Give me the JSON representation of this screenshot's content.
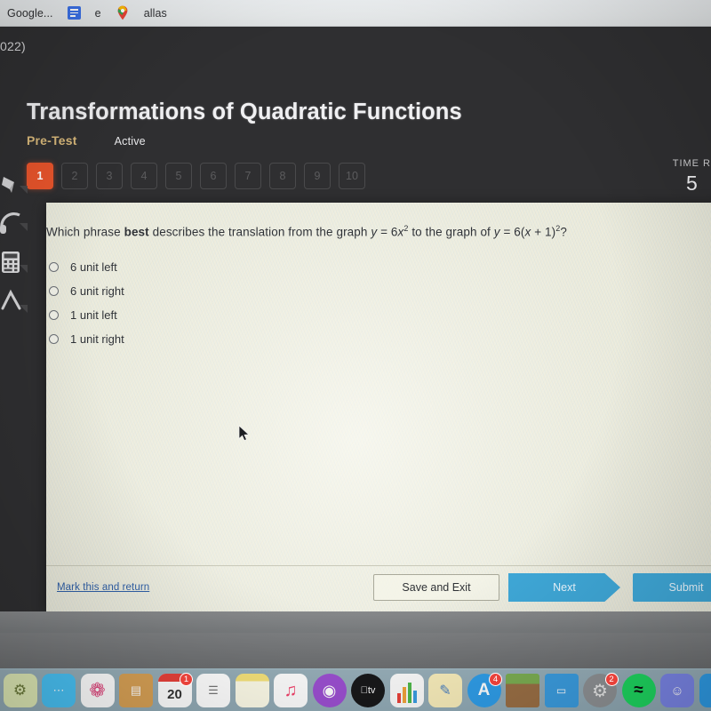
{
  "browser": {
    "bookmarks": [
      {
        "label": "Google...",
        "icon": "none"
      },
      {
        "label": "",
        "icon": "google-docs-icon"
      },
      {
        "label": "e",
        "icon": "none"
      },
      {
        "label": "",
        "icon": "google-maps-pin-icon"
      },
      {
        "label": "allas",
        "icon": "none"
      }
    ],
    "tab_title_fragment": "022)"
  },
  "quiz": {
    "title": "Transformations of Quadratic Functions",
    "test_type": "Pre-Test",
    "status": "Active",
    "question_numbers": [
      "1",
      "2",
      "3",
      "4",
      "5",
      "6",
      "7",
      "8",
      "9",
      "10"
    ],
    "active_question": "1",
    "timer": {
      "label": "TIME R",
      "value": "5"
    },
    "accent_active": "#e8542b",
    "accent_button": "#3fa8d8"
  },
  "question": {
    "prefix": "Which phrase ",
    "emphasis": "best",
    "middle": " describes the translation from the graph ",
    "expr1_var": "y",
    "expr1_eq": " = 6",
    "expr1_x": "x",
    "expr1_pow": "2",
    "mid2": " to the graph of ",
    "expr2_var": "y",
    "expr2_eq": " = 6(",
    "expr2_x": "x",
    "expr2_tail": " + 1)",
    "expr2_pow": "2",
    "suffix": "?",
    "options": [
      {
        "label": "6 unit left",
        "selected": false
      },
      {
        "label": "6 unit right",
        "selected": false
      },
      {
        "label": "1 unit left",
        "selected": false
      },
      {
        "label": "1 unit right",
        "selected": false
      }
    ]
  },
  "footer": {
    "mark_link": "Mark this and return",
    "save_label": "Save and Exit",
    "next_label": "Next",
    "submit_label": "Submit"
  },
  "tools": [
    {
      "name": "highlighter-icon"
    },
    {
      "name": "headphones-icon"
    },
    {
      "name": "calculator-icon"
    },
    {
      "name": "line-tool-icon"
    }
  ],
  "dock": {
    "items": [
      {
        "name": "finder-icon",
        "color": "#cfe4a8",
        "glyph": "⚙",
        "badge": ""
      },
      {
        "name": "messages-icon",
        "color": "#4fc3f7",
        "glyph": "●●●",
        "badge": ""
      },
      {
        "name": "photos-icon",
        "color": "#ffffff",
        "glyph": "❁",
        "badge": ""
      },
      {
        "name": "contacts-icon",
        "color": "#d8a050",
        "glyph": "▤",
        "badge": ""
      },
      {
        "name": "calendar-icon",
        "color": "#ffffff",
        "glyph": "20",
        "badge": "1"
      },
      {
        "name": "reminders-icon",
        "color": "#ffffff",
        "glyph": "☰",
        "badge": ""
      },
      {
        "name": "notes-icon",
        "color": "#fdf0b0",
        "glyph": "",
        "badge": ""
      },
      {
        "name": "music-icon",
        "color": "#ffffff",
        "glyph": "♫",
        "badge": ""
      },
      {
        "name": "podcasts-icon",
        "color": "#9b4fd0",
        "glyph": "◉",
        "badge": ""
      },
      {
        "name": "apple-tv-icon",
        "color": "#1a1a1a",
        "glyph": "tv",
        "badge": ""
      },
      {
        "name": "numbers-icon",
        "color": "#ffffff",
        "glyph": "▐",
        "badge": ""
      },
      {
        "name": "pages-icon",
        "color": "#f5e6b0",
        "glyph": "✎",
        "badge": ""
      },
      {
        "name": "app-store-icon",
        "color": "#2f9de8",
        "glyph": "A",
        "badge": "4"
      },
      {
        "name": "minecraft-icon",
        "color": "#7cae52",
        "glyph": "",
        "badge": ""
      },
      {
        "name": "zoom-display-icon",
        "color": "#3b9de0",
        "glyph": "▭",
        "badge": ""
      },
      {
        "name": "system-preferences-icon",
        "color": "#8f9295",
        "glyph": "⚙",
        "badge": "2"
      },
      {
        "name": "spotify-icon",
        "color": "#1ed760",
        "glyph": "≈",
        "badge": ""
      },
      {
        "name": "discord-icon",
        "color": "#7b86e8",
        "glyph": "◔",
        "badge": ""
      },
      {
        "name": "facetime-icon",
        "color": "#2f9de8",
        "glyph": "▶",
        "badge": ""
      },
      {
        "name": "chrome-icon",
        "color": "#ffffff",
        "glyph": "●",
        "badge": ""
      }
    ]
  }
}
